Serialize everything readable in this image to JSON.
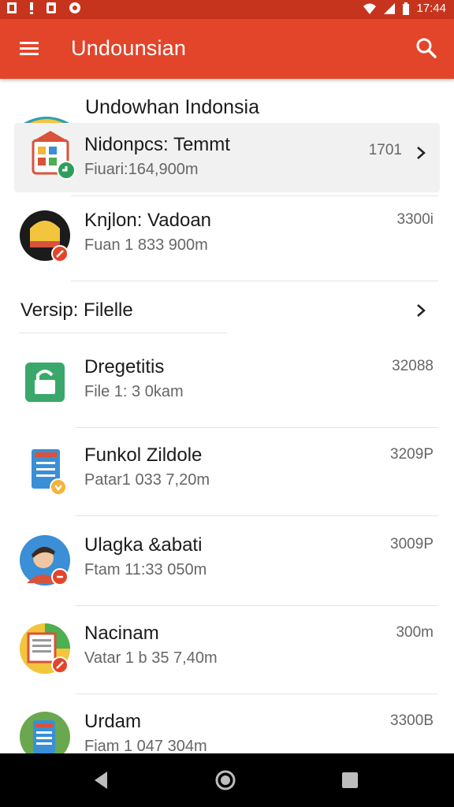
{
  "status_bar": {
    "time": "17:44"
  },
  "app_bar": {
    "title": "Undounsian"
  },
  "section": {
    "heading": "Undowhan Indonsia"
  },
  "featured": [
    {
      "name": "Nidonpcs: Temmt",
      "sub": "Fiuari:164,900m",
      "value": "1701",
      "icon": "app-store-icon"
    },
    {
      "name": "Knjlon: Vadoan",
      "sub": "Fuan 1 833 900m",
      "value": "3300i",
      "icon": "helmet-avatar-icon"
    }
  ],
  "versi": {
    "label": "Versip: Filelle"
  },
  "files": [
    {
      "name": "Dregetitis",
      "sub": "File 1: 3 0kam",
      "value": "32088",
      "icon": "lock-icon"
    },
    {
      "name": "Funkol Zildole",
      "sub": "Patar1 033 7,20m",
      "value": "3209P",
      "icon": "document-icon"
    },
    {
      "name": "Ulagka &abati",
      "sub": "Ftam 11:33 050m",
      "value": "3009P",
      "icon": "person-avatar-icon"
    },
    {
      "name": "Nacinam",
      "sub": "Vatar 1 b 35 7,40m",
      "value": "300m",
      "icon": "notebook-icon"
    },
    {
      "name": "Urdam",
      "sub": "Fiam 1 047 304m",
      "value": "3300B",
      "icon": "tablet-icon"
    }
  ]
}
